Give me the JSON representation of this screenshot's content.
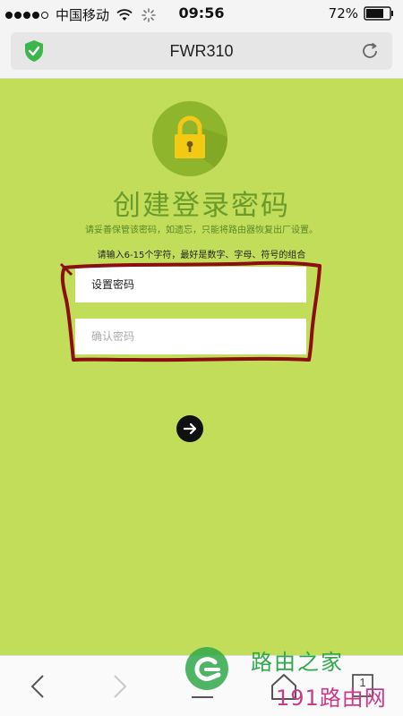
{
  "status_bar": {
    "carrier": "中国移动",
    "time": "09:56",
    "battery_percent": "72%",
    "signal_bars_filled": 4,
    "signal_bars_total": 5
  },
  "address_bar": {
    "title": "FWR310",
    "secure_icon": "shield-check-icon",
    "reload_icon": "reload-icon"
  },
  "page": {
    "icon": "lock-icon",
    "title": "创建登录密码",
    "subtitle": "请妥善保管该密码，如遗忘，只能将路由器恢复出厂设置。",
    "hint": "请输入6-15个字符，最好是数字、字母、符号的组合",
    "password_field": {
      "placeholder": "设置密码",
      "value": ""
    },
    "confirm_field": {
      "placeholder": "确认密码",
      "value": ""
    },
    "next_icon": "arrow-right-icon"
  },
  "toolbar": {
    "back_icon": "chevron-left-icon",
    "forward_icon": "chevron-right-icon",
    "menu_icon": "menu-icon",
    "home_icon": "home-icon",
    "tabs_count": "1"
  },
  "watermark": {
    "line1": "路由之家",
    "line2": "191路由网"
  },
  "colors": {
    "page_background": "#c2dd5a",
    "title_green": "#6b9a2b",
    "lock_circle": "#8fb52d",
    "lock_yellow": "#f2c913",
    "annotation_red": "#8b0f12"
  }
}
